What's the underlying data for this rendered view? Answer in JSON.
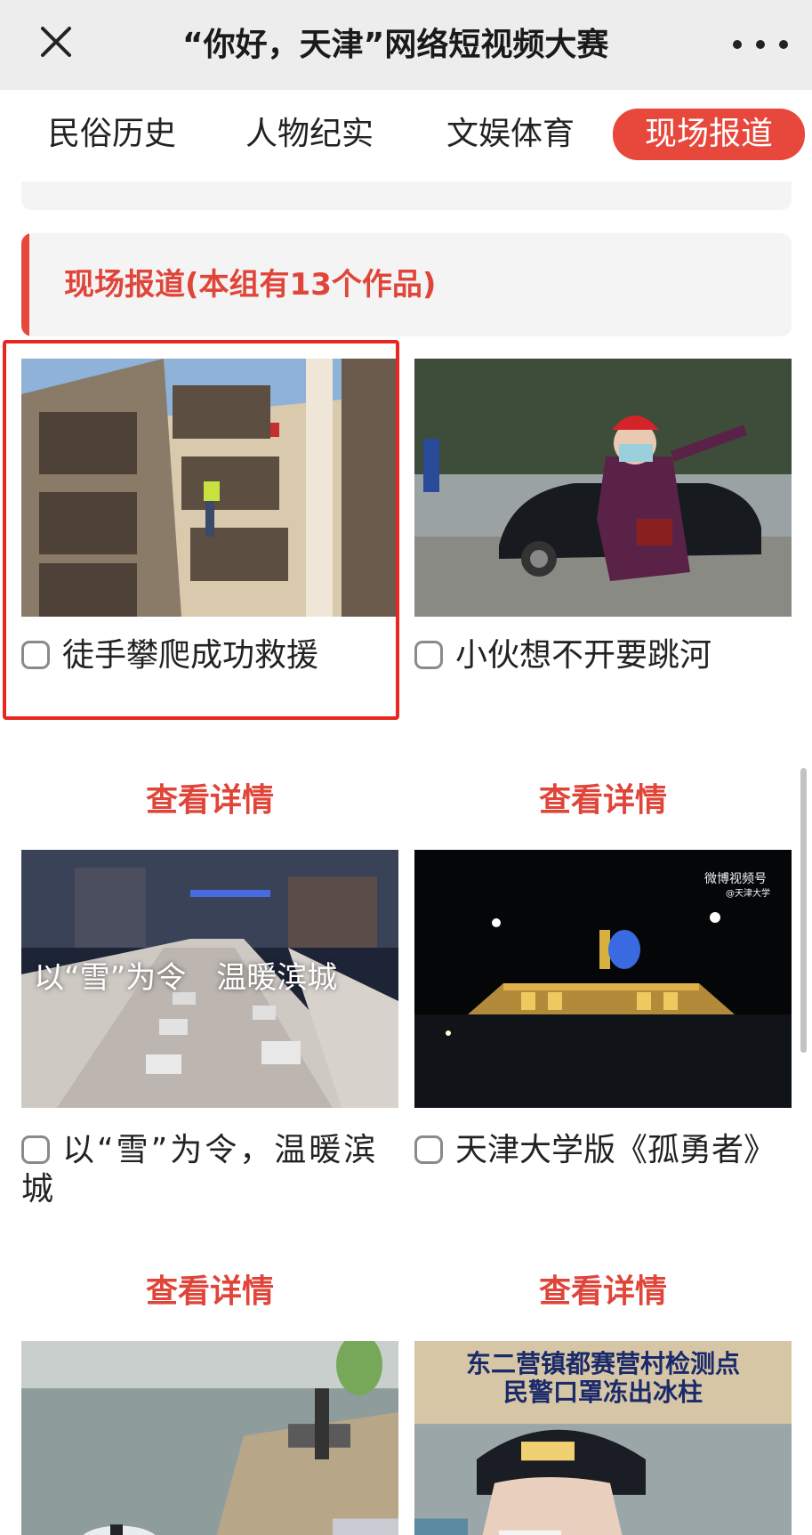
{
  "topbar": {
    "title": "“你好，天津”网络短视频大赛",
    "close_icon": "close-icon",
    "more_icon": "more-icon"
  },
  "tabs": [
    {
      "label": "民俗历史",
      "active": false
    },
    {
      "label": "人物纪实",
      "active": false
    },
    {
      "label": "文娱体育",
      "active": false
    },
    {
      "label": "现场报道",
      "active": true
    }
  ],
  "section": {
    "title": "现场报道(本组有13个作品)"
  },
  "items": [
    {
      "title": "徒手攀爬成功救援",
      "detail": "查看详情",
      "checked": false
    },
    {
      "title": "小伙想不开要跳河",
      "detail": "查看详情",
      "checked": false
    },
    {
      "title": "以“雪”为令，温暖滨城",
      "detail": "查看详情",
      "checked": false,
      "overlay": "以“雪”为令　温暖滨城"
    },
    {
      "title": "天津大学版《孤勇者》",
      "detail": "查看详情",
      "checked": false,
      "overlay_logo": "微博视频号",
      "overlay_sub": "@天津大学"
    },
    {
      "title": "",
      "checked": false
    },
    {
      "title": "",
      "checked": false,
      "overlay_line1": "东二营镇都赛营村检测点",
      "overlay_line2": "民警口罩冻出冰柱"
    }
  ],
  "colors": {
    "accent": "#e8473c",
    "topbar_bg": "#ededed",
    "section_bg": "#f4f4f4",
    "highlight": "#e8271f"
  }
}
